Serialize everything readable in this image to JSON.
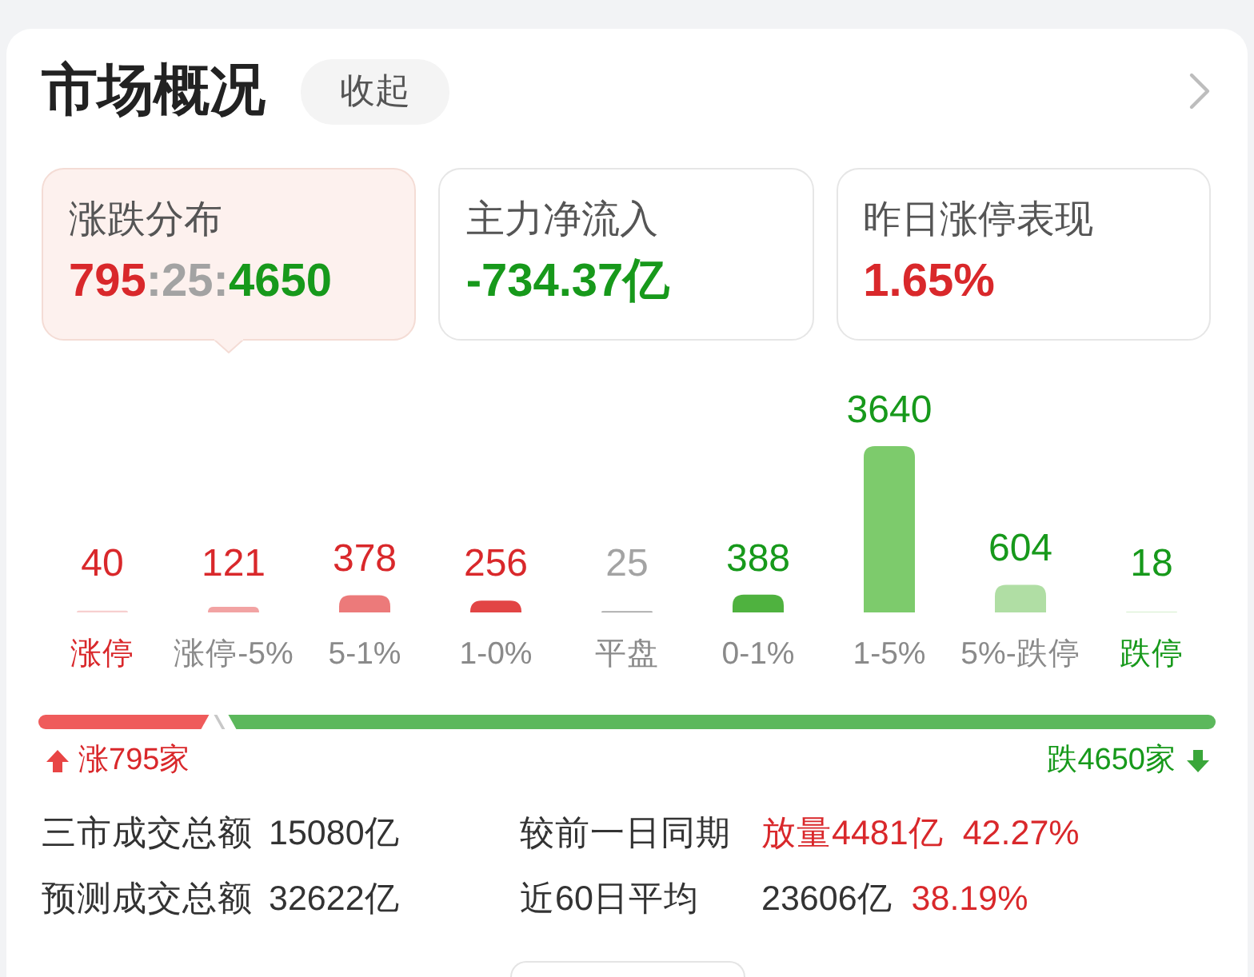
{
  "header": {
    "title": "市场概况",
    "collapse_button": "收起"
  },
  "summary_cards": [
    {
      "label": "涨跌分布",
      "selected": true,
      "value_parts": [
        {
          "text": "795",
          "color": "#d9282b"
        },
        {
          "text": ":25:",
          "color": "#a3a3a3"
        },
        {
          "text": "4650",
          "color": "#17991b"
        }
      ]
    },
    {
      "label": "主力净流入",
      "selected": false,
      "value_parts": [
        {
          "text": "-734.37亿",
          "color": "#17991b"
        }
      ]
    },
    {
      "label": "昨日涨停表现",
      "selected": false,
      "value_parts": [
        {
          "text": "1.65%",
          "color": "#d9282b"
        }
      ]
    }
  ],
  "distribution": {
    "chart_data": {
      "type": "bar",
      "categories": [
        "涨停",
        "涨停-5%",
        "5-1%",
        "1-0%",
        "平盘",
        "0-1%",
        "1-5%",
        "5%-跌停",
        "跌停"
      ],
      "values": [
        40,
        121,
        378,
        256,
        25,
        388,
        3640,
        604,
        18
      ],
      "data_labels": true,
      "colors": [
        "#f7cfcf",
        "#f2a3a3",
        "#ec7a7a",
        "#e24545",
        "#9b9b9b",
        "#4fb23f",
        "#7dcb6c",
        "#b0dea4",
        "#d4efcd"
      ]
    },
    "value_labels": [
      {
        "color": "#d9282b"
      },
      {
        "color": "#d9282b"
      },
      {
        "color": "#d9282b"
      },
      {
        "color": "#d9282b"
      },
      {
        "color": "#a3a3a3"
      },
      {
        "color": "#17991b"
      },
      {
        "color": "#17991b"
      },
      {
        "color": "#17991b"
      },
      {
        "color": "#17991b"
      }
    ],
    "category_labels": [
      {
        "color": "#d9282b"
      },
      {
        "color": "#8a8a8a"
      },
      {
        "color": "#8a8a8a"
      },
      {
        "color": "#8a8a8a"
      },
      {
        "color": "#8a8a8a"
      },
      {
        "color": "#8a8a8a"
      },
      {
        "color": "#8a8a8a"
      },
      {
        "color": "#8a8a8a"
      },
      {
        "color": "#17991b"
      }
    ]
  },
  "ratio_bar": {
    "level": 0.145,
    "up_label": "涨795家",
    "down_label": "跌4650家"
  },
  "stats": [
    {
      "label": "三市成交总额",
      "values": [
        {
          "text": "15080亿",
          "color": "#333333"
        }
      ]
    },
    {
      "label": "较前一日同期",
      "values": [
        {
          "text": "放量4481亿",
          "color": "#d9282b"
        },
        {
          "text": "42.27%",
          "color": "#d9282b"
        }
      ]
    },
    {
      "label": "预测成交总额",
      "values": [
        {
          "text": "32622亿",
          "color": "#333333"
        }
      ]
    },
    {
      "label": "近60日平均",
      "values": [
        {
          "text": "23606亿",
          "color": "#333333"
        },
        {
          "text": "38.19%",
          "color": "#d9282b"
        }
      ]
    }
  ]
}
